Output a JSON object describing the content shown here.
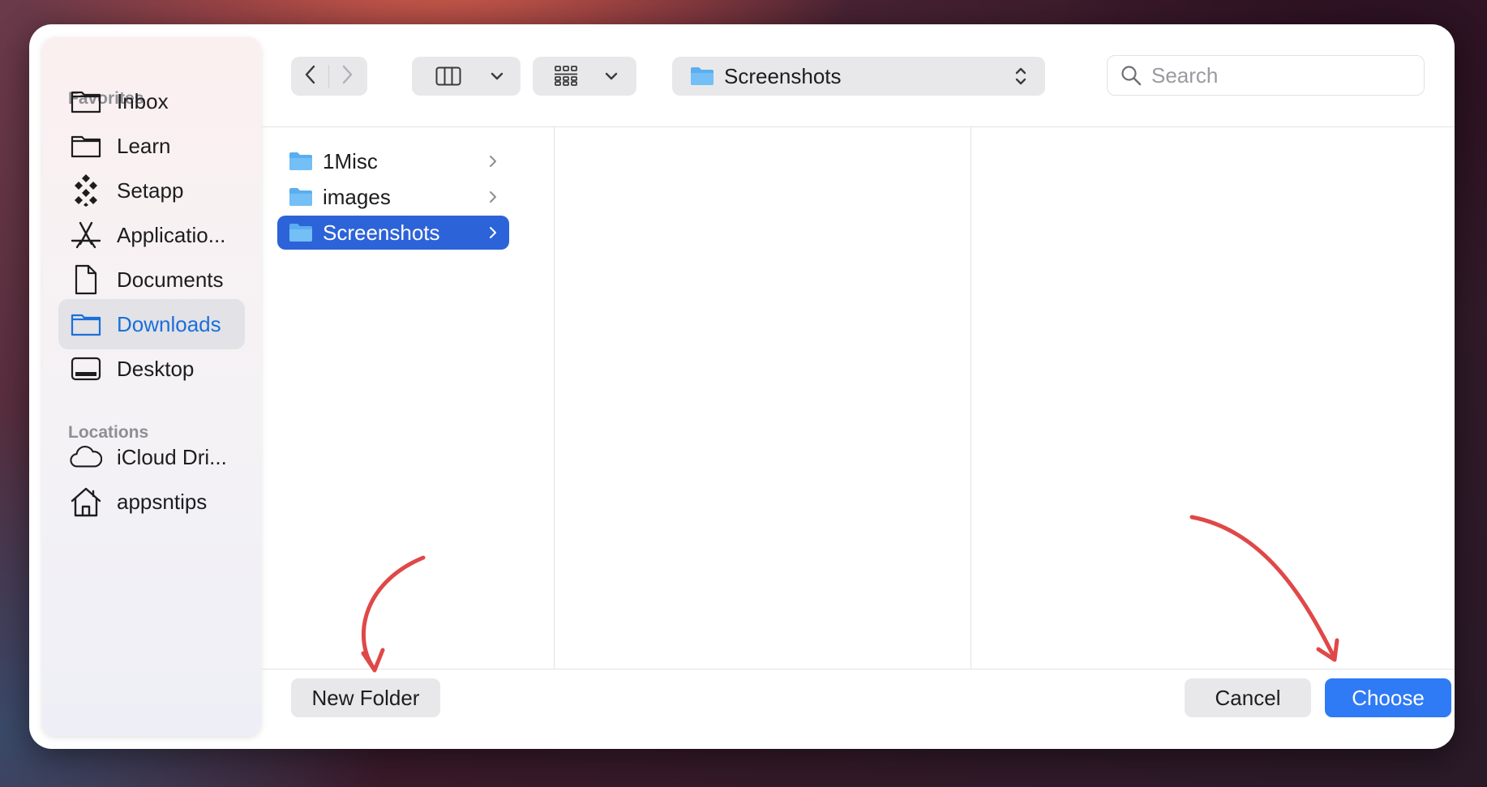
{
  "sidebar": {
    "favorites_title": "Favorites",
    "favorites": [
      {
        "label": "Inbox",
        "icon": "folder-icon"
      },
      {
        "label": "Learn",
        "icon": "folder-icon"
      },
      {
        "label": "Setapp",
        "icon": "setapp-icon"
      },
      {
        "label": "Applicatio...",
        "icon": "applications-icon"
      },
      {
        "label": "Documents",
        "icon": "document-icon"
      },
      {
        "label": "Downloads",
        "icon": "folder-icon",
        "selected": true
      },
      {
        "label": "Desktop",
        "icon": "desktop-icon"
      }
    ],
    "locations_title": "Locations",
    "locations": [
      {
        "label": "iCloud Dri...",
        "icon": "cloud-icon"
      },
      {
        "label": "appsntips",
        "icon": "home-icon"
      }
    ]
  },
  "toolbar": {
    "path_label": "Screenshots",
    "search_placeholder": "Search"
  },
  "browser": {
    "column1": [
      {
        "label": "1Misc",
        "selected": false
      },
      {
        "label": "images",
        "selected": false
      },
      {
        "label": "Screenshots",
        "selected": true
      }
    ]
  },
  "footer": {
    "new_folder_label": "New Folder",
    "cancel_label": "Cancel",
    "choose_label": "Choose"
  },
  "colors": {
    "accent": "#2f7af5",
    "selection": "#2d63d8",
    "sidebar_selected_text": "#1b6fd9",
    "annotation_arrow": "#e04848"
  }
}
